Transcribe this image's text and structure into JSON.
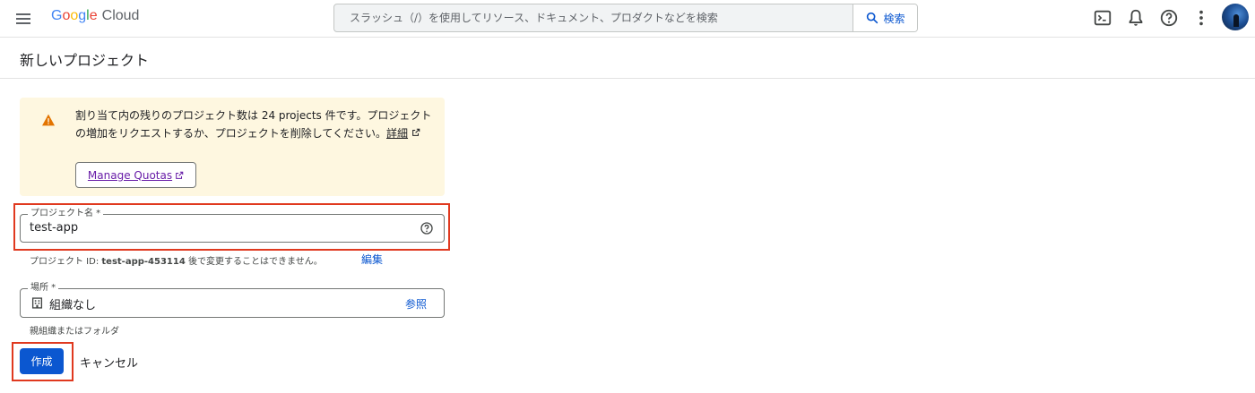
{
  "header": {
    "logo_google": [
      "G",
      "o",
      "o",
      "g",
      "l",
      "e"
    ],
    "logo_cloud": "Cloud",
    "search_placeholder": "スラッシュ（/）を使用してリソース、ドキュメント、プロダクトなどを検索",
    "search_button": "検索",
    "icons": [
      "menu-icon",
      "search-icon",
      "cloud-shell-icon",
      "notifications-icon",
      "help-icon",
      "more-vert-icon",
      "avatar"
    ]
  },
  "page": {
    "title": "新しいプロジェクト"
  },
  "warning": {
    "text": "割り当て内の残りのプロジェクト数は 24 projects 件です。プロジェクトの増加をリクエストするか、プロジェクトを削除してください。",
    "details_link": "詳細",
    "quota_button": "Manage Quotas"
  },
  "project_name": {
    "label": "プロジェクト名 *",
    "value": "test-app",
    "id_prefix": "プロジェクト ID: ",
    "id_value": "test-app-453114",
    "id_suffix": " 後で変更することはできません。",
    "edit_link": "編集"
  },
  "location": {
    "label": "場所 *",
    "value": "組織なし",
    "browse_link": "参照",
    "hint": "親組織またはフォルダ"
  },
  "actions": {
    "create": "作成",
    "cancel": "キャンセル"
  },
  "colors": {
    "primary": "#0b57d0",
    "warning_bg": "#fef7e0",
    "warning_icon": "#e37400",
    "highlight_box": "#e0391f",
    "visited_link": "#681da8"
  }
}
